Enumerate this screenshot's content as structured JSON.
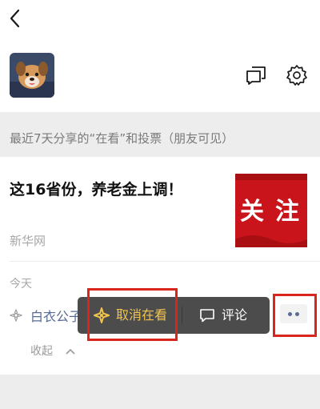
{
  "header": {
    "back_icon": "chevron-left-icon",
    "avatar_icon": "dog-avatar",
    "message_icon": "chat-bubbles-icon",
    "settings_icon": "gear-icon"
  },
  "section_label": "最近7天分享的“在看”和投票（朋友可见）",
  "article": {
    "title": "这16省份，养老金上调！",
    "source": "新华网",
    "thumb_text_left": "关",
    "thumb_text_right": "注",
    "thumb_color": "#c8141a"
  },
  "activity": {
    "date_label": "今天",
    "friend_name": "白衣公子",
    "collapse_label": "收起"
  },
  "popup": {
    "cancel_label": "取消在看",
    "cancel_color": "#f2c44d",
    "comment_label": "评论"
  },
  "colors": {
    "link": "#576b95",
    "highlight": "#d9251c"
  }
}
